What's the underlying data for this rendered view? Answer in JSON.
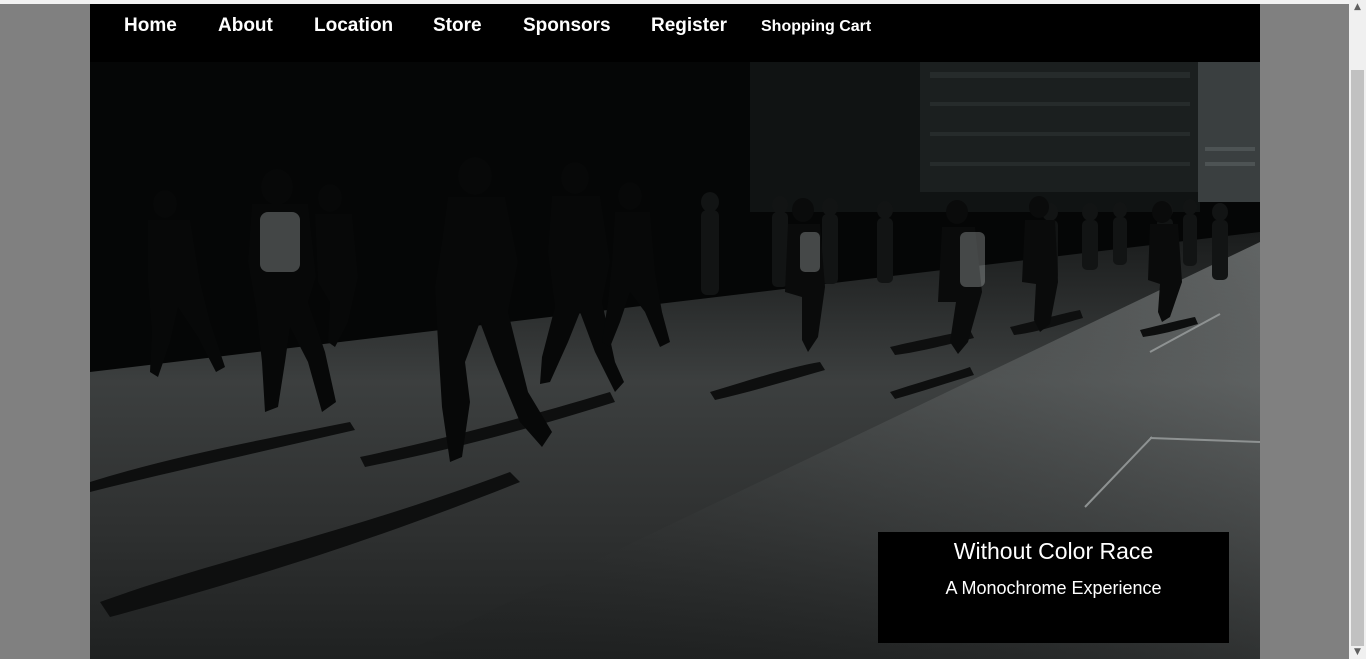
{
  "nav": {
    "items": [
      {
        "label": "Home"
      },
      {
        "label": "About"
      },
      {
        "label": "Location"
      },
      {
        "label": "Store"
      },
      {
        "label": "Sponsors"
      },
      {
        "label": "Register"
      },
      {
        "label": "Shopping Cart"
      }
    ]
  },
  "hero": {
    "caption_title": "Without Color Race",
    "caption_subtitle": "A Monochrome Experience",
    "image_subject": "monochrome-marathon-runners-photo"
  },
  "colors": {
    "page_background": "#808080",
    "navbar_background": "#000000",
    "nav_text": "#ffffff",
    "caption_background": "#000000",
    "caption_text": "#ffffff"
  },
  "scrollbar": {
    "up_arrow": "▲",
    "down_arrow": "▼"
  }
}
